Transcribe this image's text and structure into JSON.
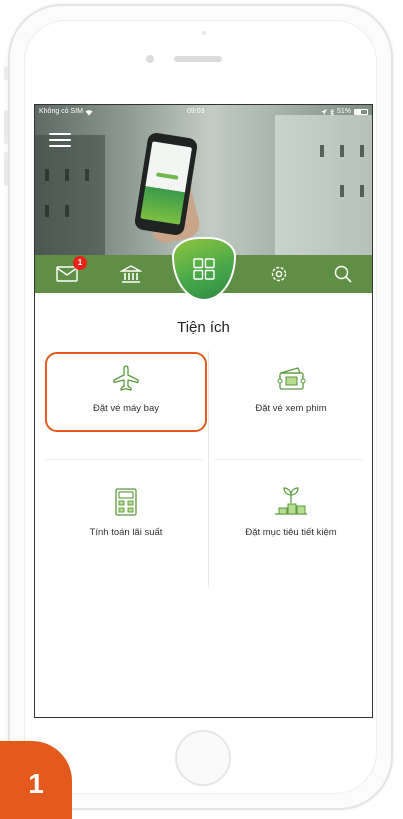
{
  "status_bar": {
    "carrier": "Không có SIM",
    "time": "09:03",
    "battery_percent": "51%",
    "battery_level": 0.51
  },
  "nav": {
    "items": [
      {
        "icon": "mail-icon",
        "badge": "1"
      },
      {
        "icon": "bank-icon"
      },
      {
        "icon": "apps-grid-icon"
      },
      {
        "icon": "gear-icon"
      },
      {
        "icon": "search-icon"
      }
    ]
  },
  "utilities": {
    "title": "Tiện ích",
    "tiles": [
      {
        "label": "Đặt vé máy bay",
        "icon": "airplane-icon",
        "highlighted": true
      },
      {
        "label": "Đặt vé xem phim",
        "icon": "movie-ticket-icon",
        "highlighted": false
      },
      {
        "label": "Tính toán lãi suất",
        "icon": "calculator-icon",
        "highlighted": false
      },
      {
        "label": "Đặt mục tiêu tiết kiệm",
        "icon": "savings-plant-icon",
        "highlighted": false
      }
    ]
  },
  "step": {
    "number": "1"
  },
  "colors": {
    "brand_green": "#5f8f45",
    "icon_green": "#5a9a3e",
    "highlight_orange": "#e35a1c",
    "badge_red": "#e8231a"
  }
}
